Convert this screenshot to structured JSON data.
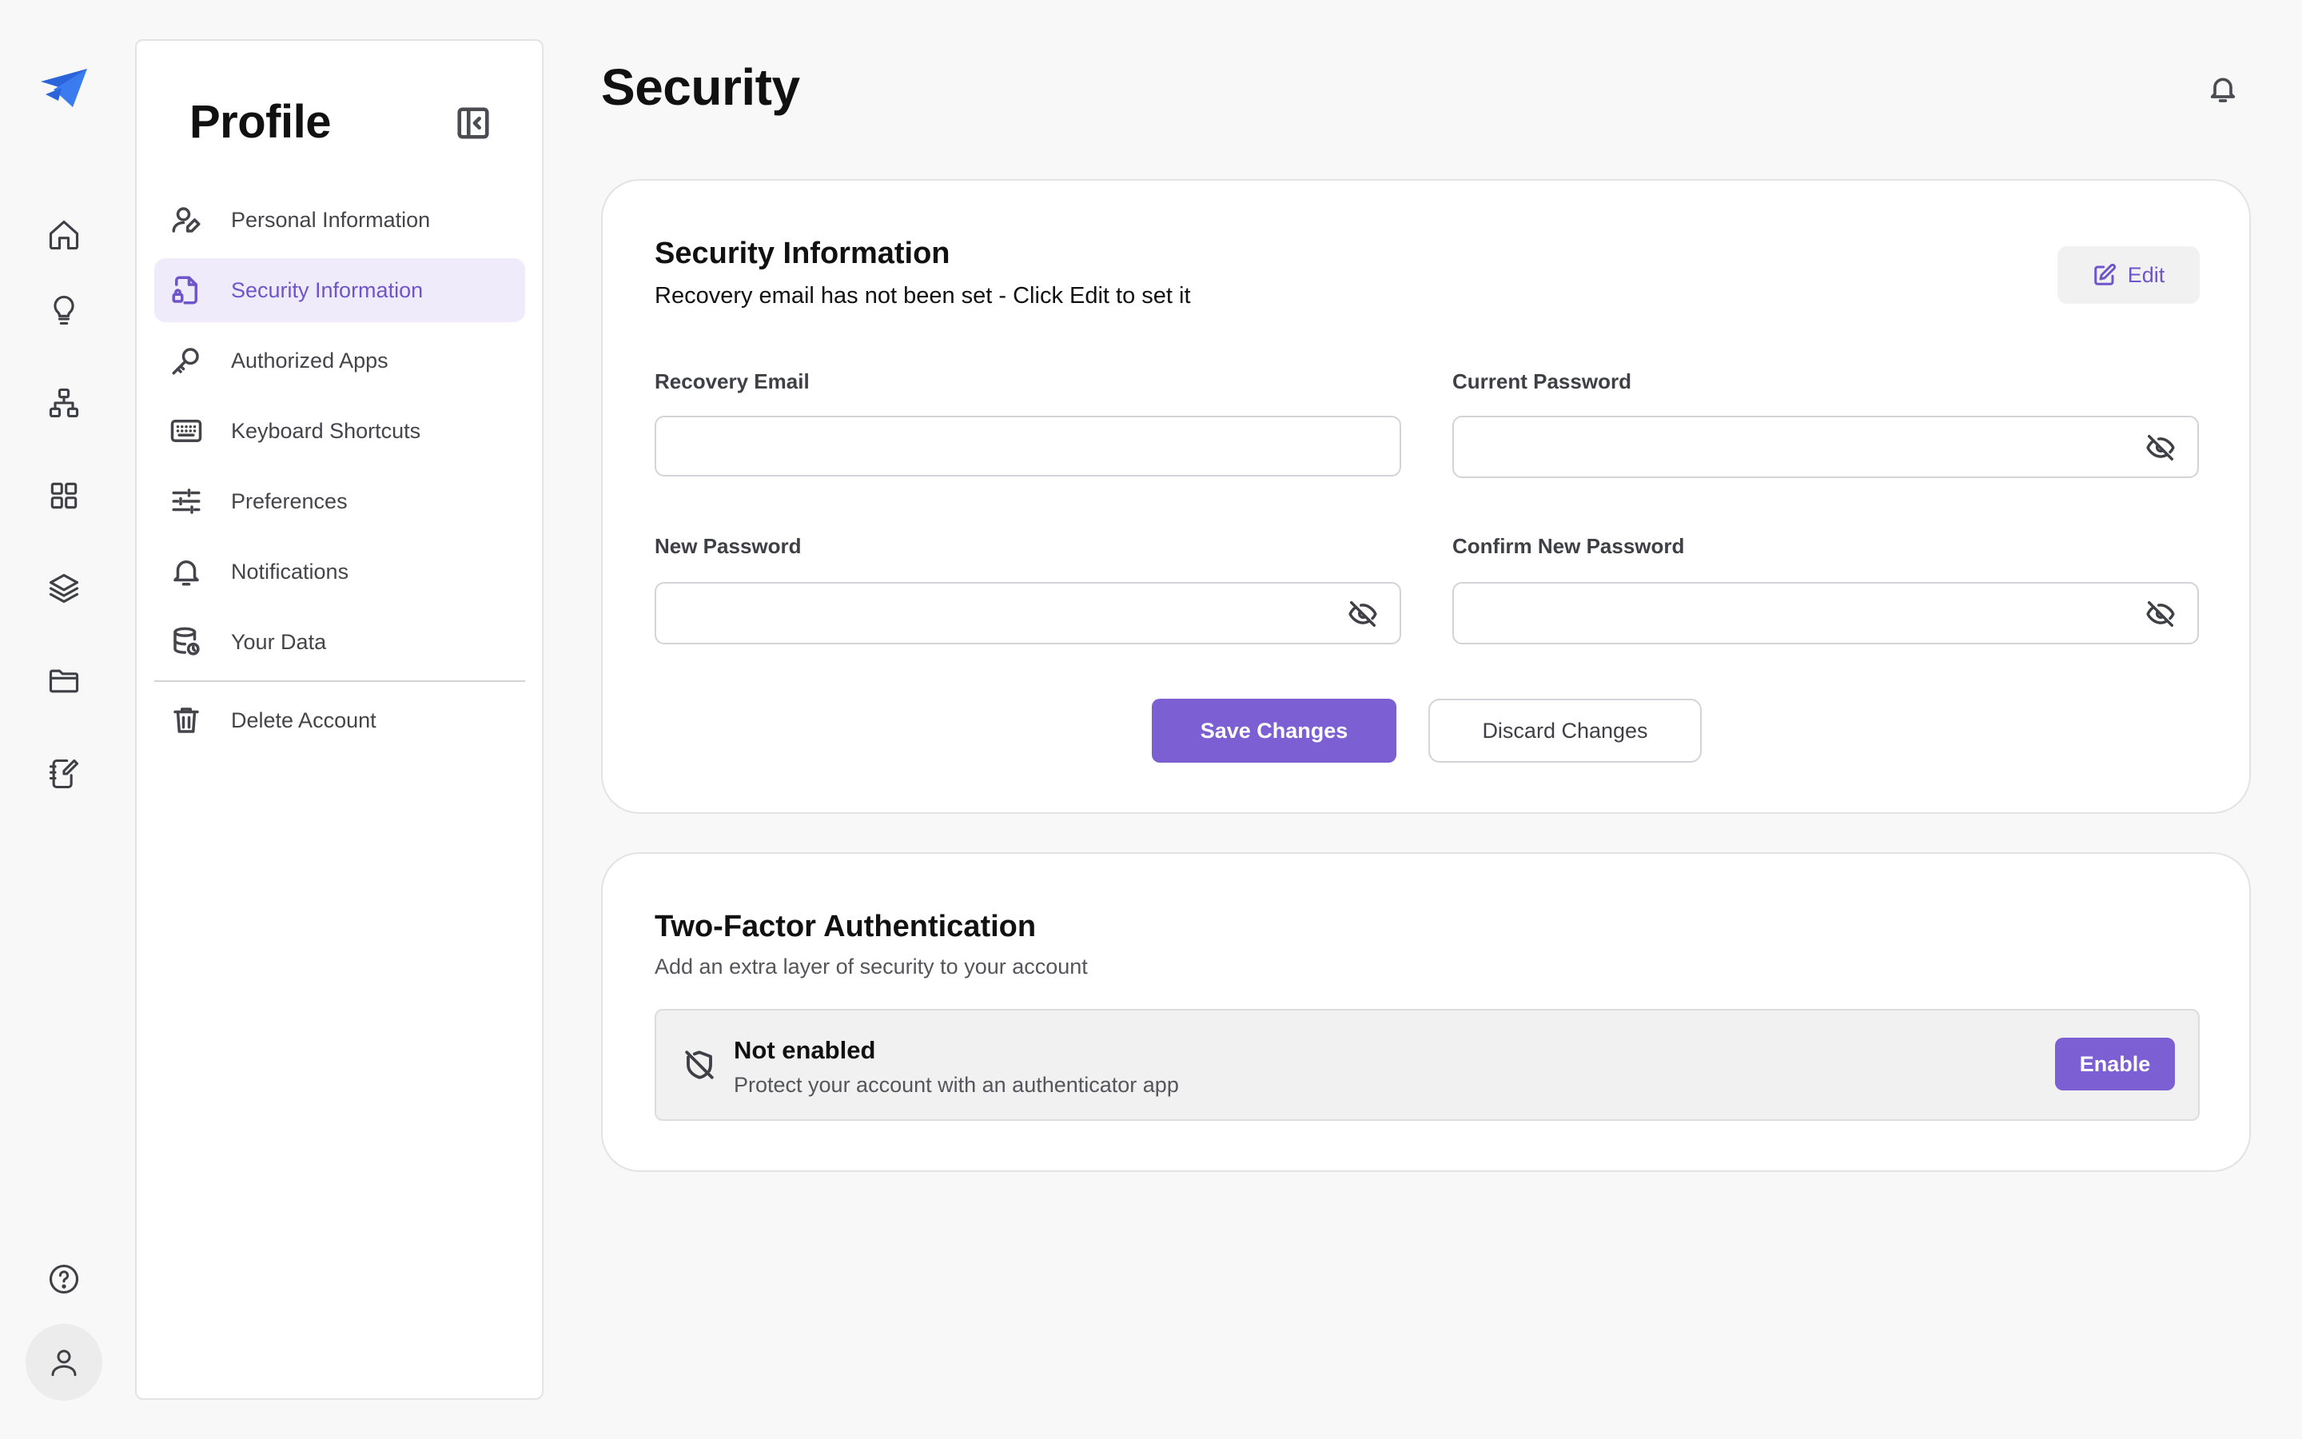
{
  "rail": {
    "items": [
      {
        "icon": "logo-icon"
      },
      {
        "icon": "home-icon"
      },
      {
        "icon": "lightbulb-icon"
      },
      {
        "icon": "sitemap-icon"
      },
      {
        "icon": "grid-icon"
      },
      {
        "icon": "layers-icon"
      },
      {
        "icon": "folder-icon"
      },
      {
        "icon": "notebook-edit-icon"
      },
      {
        "icon": "help-icon"
      },
      {
        "icon": "user-icon"
      }
    ]
  },
  "profile": {
    "title": "Profile",
    "nav": [
      {
        "label": "Personal Information",
        "icon": "user-edit-icon"
      },
      {
        "label": "Security Information",
        "icon": "file-lock-icon",
        "active": true
      },
      {
        "label": "Authorized Apps",
        "icon": "key-icon"
      },
      {
        "label": "Keyboard Shortcuts",
        "icon": "keyboard-icon"
      },
      {
        "label": "Preferences",
        "icon": "sliders-icon"
      },
      {
        "label": "Notifications",
        "icon": "bell-icon"
      },
      {
        "label": "Your Data",
        "icon": "database-icon"
      },
      {
        "label": "Delete Account",
        "icon": "trash-icon"
      }
    ]
  },
  "page": {
    "title": "Security"
  },
  "security": {
    "title": "Security Information",
    "subtitle": "Recovery email has not been set - Click Edit to set it",
    "edit_label": "Edit",
    "fields": {
      "recovery_email": {
        "label": "Recovery Email",
        "value": ""
      },
      "current_password": {
        "label": "Current Password",
        "value": ""
      },
      "new_password": {
        "label": "New Password",
        "value": ""
      },
      "confirm_password": {
        "label": "Confirm New Password",
        "value": ""
      }
    },
    "save_label": "Save Changes",
    "discard_label": "Discard Changes"
  },
  "two_factor": {
    "title": "Two-Factor Authentication",
    "subtitle": "Add an extra layer of security to your account",
    "status": "Not enabled",
    "description": "Protect your account with an authenticator app",
    "enable_label": "Enable"
  },
  "colors": {
    "accent": "#7b5fd3",
    "accent_text": "#6e55c9",
    "active_nav_bg": "#efebfb",
    "background": "#f8f8f8"
  }
}
